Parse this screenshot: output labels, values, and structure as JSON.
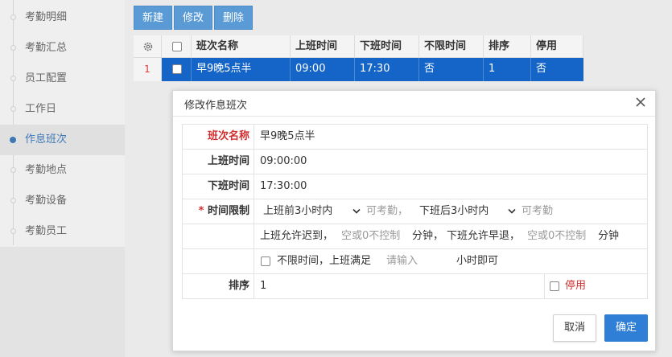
{
  "sidebar": {
    "items": [
      {
        "label": "考勤明细",
        "active": false
      },
      {
        "label": "考勤汇总",
        "active": false
      },
      {
        "label": "员工配置",
        "active": false
      },
      {
        "label": "工作日",
        "active": false
      },
      {
        "label": "作息班次",
        "active": true
      },
      {
        "label": "考勤地点",
        "active": false
      },
      {
        "label": "考勤设备",
        "active": false
      },
      {
        "label": "考勤员工",
        "active": false
      }
    ]
  },
  "toolbar": {
    "new_label": "新建",
    "edit_label": "修改",
    "delete_label": "删除"
  },
  "grid": {
    "columns": [
      "班次名称",
      "上班时间",
      "下班时间",
      "不限时间",
      "排序",
      "停用"
    ],
    "rows": [
      {
        "index": "1",
        "cells": [
          "早9晚5点半",
          "09:00",
          "17:30",
          "否",
          "1",
          "否"
        ]
      }
    ]
  },
  "dialog": {
    "title": "修改作息班次",
    "fields": {
      "name_label": "班次名称",
      "name_value": "早9晚5点半",
      "start_label": "上班时间",
      "start_value": "09:00:00",
      "end_label": "下班时间",
      "end_value": "17:30:00",
      "limit_required": "*",
      "limit_label": "时间限制",
      "before_select": "上班前3小时内",
      "before_suffix": "可考勤，",
      "after_select": "下班后3小时内",
      "after_suffix": "可考勤",
      "late_prefix": "上班允许迟到，",
      "late_placeholder": "空或0不控制",
      "late_unit": "分钟，",
      "early_prefix": "下班允许早退，",
      "early_placeholder": "空或0不控制",
      "early_unit": "分钟",
      "unlimited_label": "不限时间，上班满足",
      "hours_placeholder": "请输入",
      "hours_suffix": "小时即可",
      "sort_label": "排序",
      "sort_value": "1",
      "disable_label": "停用"
    },
    "cancel_label": "取消",
    "ok_label": "确定"
  }
}
